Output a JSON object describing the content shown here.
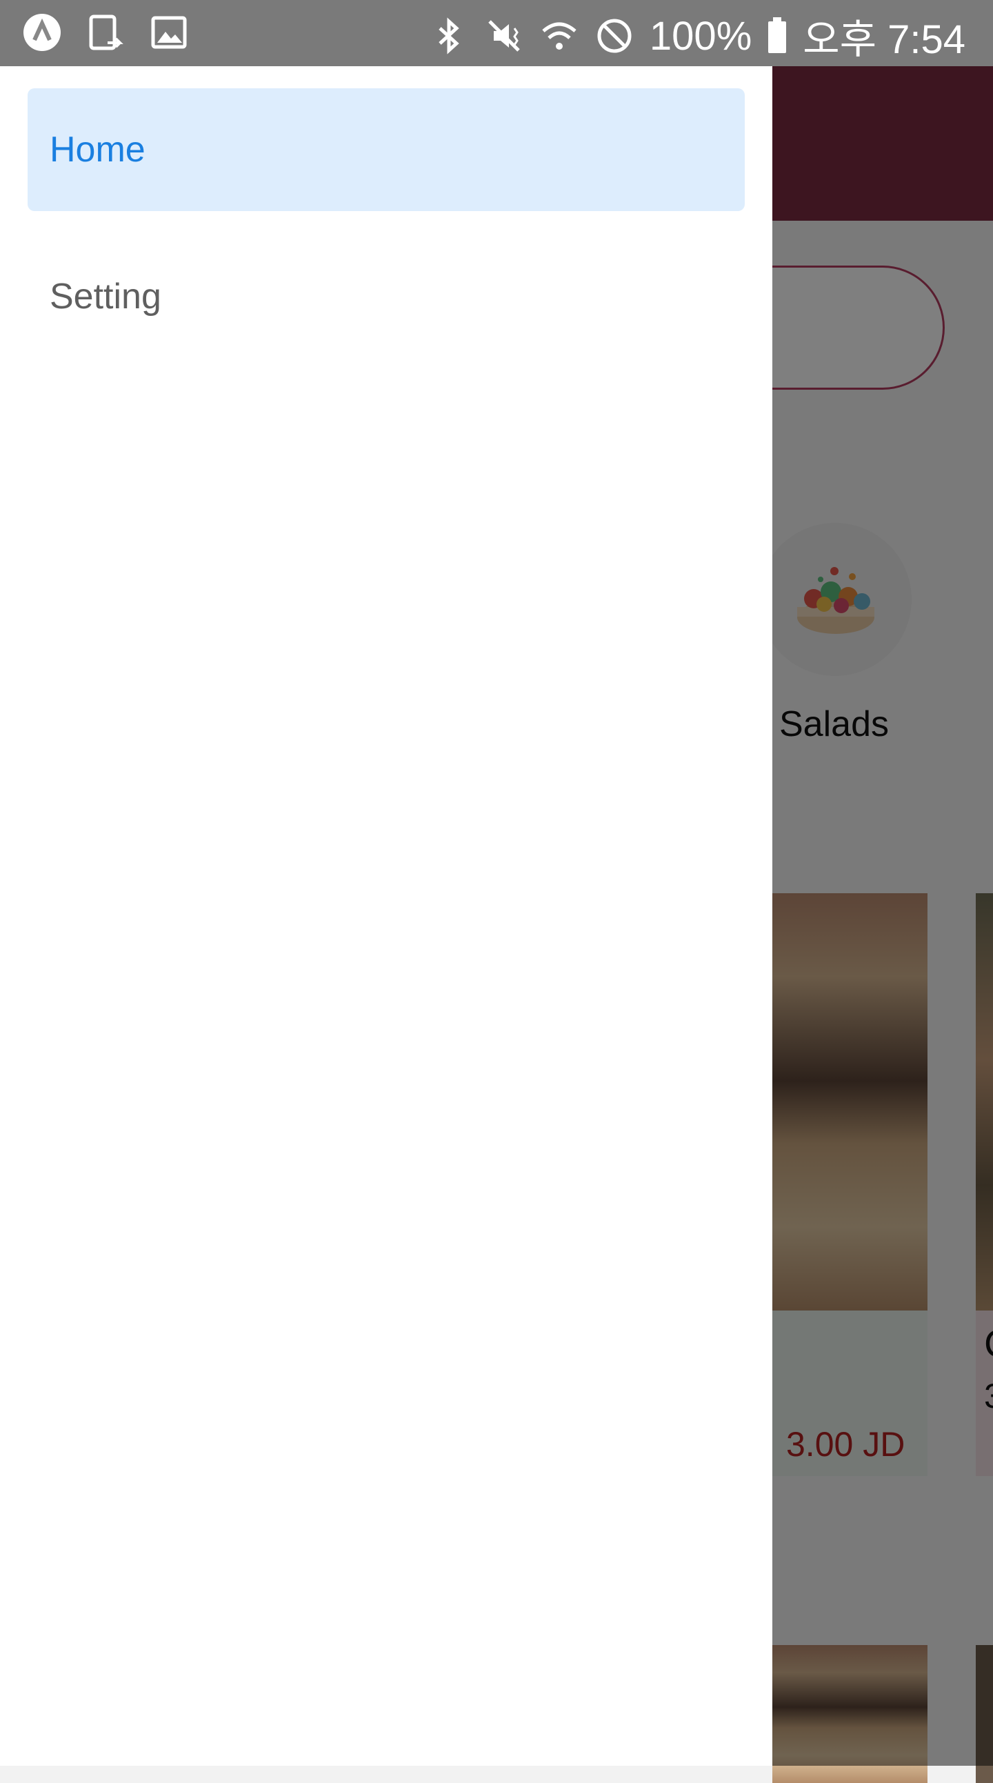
{
  "status_bar": {
    "battery": "100%",
    "time": "오후 7:54"
  },
  "drawer": {
    "items": [
      {
        "label": "Home",
        "active": true
      },
      {
        "label": "Setting",
        "active": false
      }
    ]
  },
  "background": {
    "category_label": "Salads",
    "card_price": "3.00 JD",
    "card2_title_fragment": "C",
    "card2_price_fragment": "3"
  },
  "colors": {
    "header": "#7a2a41",
    "active_item_bg": "#ddedfd",
    "active_item_text": "#1a7fe0",
    "price": "#b02020"
  }
}
